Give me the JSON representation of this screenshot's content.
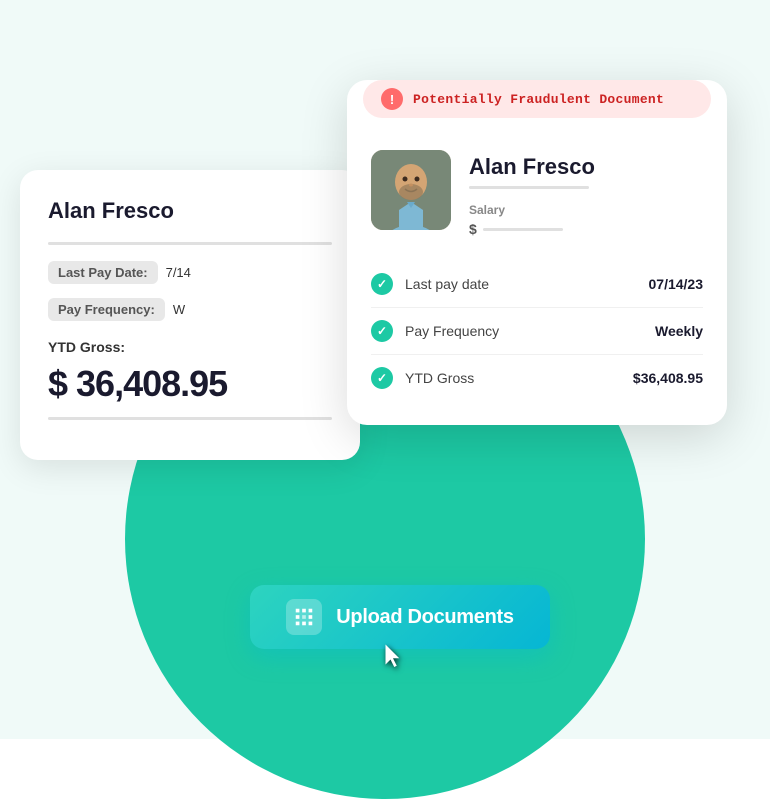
{
  "scene": {
    "bg_color": "#f0faf8",
    "teal_accent": "#1dc9a4"
  },
  "back_card": {
    "name": "Alan Fresco",
    "last_pay_label": "Last Pay Date:",
    "last_pay_value": "7/14",
    "pay_freq_label": "Pay Frequency:",
    "pay_freq_value": "W",
    "ytd_label": "YTD Gross:",
    "ytd_amount": "$ 36,408.95"
  },
  "front_card": {
    "fraud_banner": "Potentially Fraudulent Document",
    "name": "Alan Fresco",
    "salary_label": "Salary",
    "salary_dollar": "$",
    "rows": [
      {
        "key": "Last pay date",
        "value": "07/14/23"
      },
      {
        "key": "Pay Frequency",
        "value": "Weekly"
      },
      {
        "key": "YTD Gross",
        "value": "$36,408.95"
      }
    ]
  },
  "upload_button": {
    "label": "Upload Documents",
    "icon": "upload-icon"
  },
  "cursor": {
    "symbol": "➤"
  }
}
